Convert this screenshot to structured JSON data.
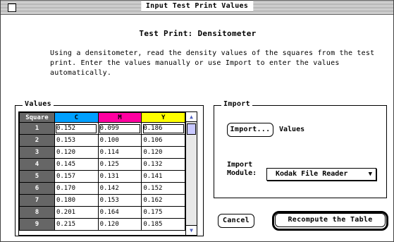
{
  "window": {
    "title": "Input Test Print Values"
  },
  "heading": "Test Print: Densitometer",
  "instructions": "Using a densitometer, read the density values of the squares from the test print.  Enter the values manually or use Import to enter the values automatically.",
  "values_group": {
    "label": "Values",
    "columns": [
      {
        "label": "Square",
        "color": "#666666"
      },
      {
        "label": "C",
        "color": "#00a0ff"
      },
      {
        "label": "M",
        "color": "#ff00a0"
      },
      {
        "label": "Y",
        "color": "#ffff00"
      }
    ],
    "rows": [
      {
        "square": "1",
        "c": "0.152",
        "m": "0.099",
        "y": "0.186"
      },
      {
        "square": "2",
        "c": "0.153",
        "m": "0.100",
        "y": "0.106"
      },
      {
        "square": "3",
        "c": "0.120",
        "m": "0.114",
        "y": "0.120"
      },
      {
        "square": "4",
        "c": "0.145",
        "m": "0.125",
        "y": "0.132"
      },
      {
        "square": "5",
        "c": "0.157",
        "m": "0.131",
        "y": "0.141"
      },
      {
        "square": "6",
        "c": "0.170",
        "m": "0.142",
        "y": "0.152"
      },
      {
        "square": "7",
        "c": "0.180",
        "m": "0.153",
        "y": "0.162"
      },
      {
        "square": "8",
        "c": "0.201",
        "m": "0.164",
        "y": "0.175"
      },
      {
        "square": "9",
        "c": "0.215",
        "m": "0.120",
        "y": "0.185"
      }
    ]
  },
  "import_group": {
    "label": "Import",
    "import_button": "Import...",
    "values_label": "Values",
    "module_label_line1": "Import",
    "module_label_line2": "Module:",
    "module_selected": "Kodak File Reader"
  },
  "buttons": {
    "cancel": "Cancel",
    "recompute": "Recompute the Table"
  }
}
